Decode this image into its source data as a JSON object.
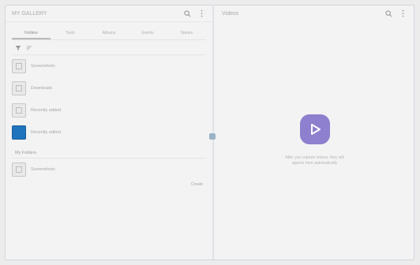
{
  "left_panel": {
    "title": "MY GALLERY",
    "tabs": [
      {
        "label": "Folders",
        "active": true
      },
      {
        "label": "Tools",
        "active": false
      },
      {
        "label": "Albums",
        "active": false
      },
      {
        "label": "Events",
        "active": false
      },
      {
        "label": "Stories",
        "active": false
      }
    ],
    "items": [
      {
        "label": "Screenshots",
        "icon": "image-icon",
        "highlight": false
      },
      {
        "label": "Downloads",
        "icon": "image-icon",
        "highlight": false
      },
      {
        "label": "Recently added",
        "icon": "image-icon",
        "highlight": false
      },
      {
        "label": "Recently edited",
        "icon": "image-icon",
        "highlight": true
      }
    ],
    "section": {
      "title": "My Folders",
      "items": [
        {
          "label": "Screenshots",
          "icon": "image-icon"
        }
      ],
      "link": "Create"
    }
  },
  "right_panel": {
    "title": "Videos",
    "empty_state": {
      "icon": "play-icon",
      "line1": "After you capture videos, they will",
      "line2": "appear here automatically"
    }
  },
  "colors": {
    "accent": "#8e7fcf",
    "highlight_thumb": "#1f74bd"
  }
}
